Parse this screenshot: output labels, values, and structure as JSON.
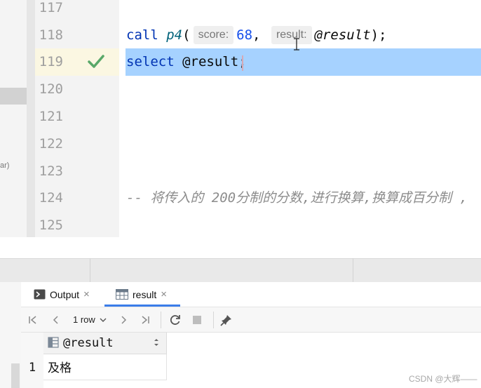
{
  "editor": {
    "line_numbers": [
      "117",
      "118",
      "119",
      "120",
      "121",
      "122",
      "123",
      "124",
      "125"
    ],
    "line118": {
      "kw_call": "call",
      "fn_name": "p4",
      "open_paren": "(",
      "hint_score": "score:",
      "arg_score": "68",
      "comma": ",",
      "hint_result": "result:",
      "arg_result": "@result",
      "close": ");"
    },
    "line119": {
      "kw_select": "select",
      "var": "@result",
      "semicolon": ";"
    },
    "line124_comment": "-- 将传入的 200分制的分数,进行换算,换算成百分制 ,",
    "line119_status": "check-icon",
    "left_panel_fragment": "ar)"
  },
  "tool_window": {
    "tabs": [
      {
        "label": "Output",
        "icon": "output-icon"
      },
      {
        "label": "result",
        "icon": "table-icon"
      }
    ],
    "close_glyph": "×",
    "toolbar": {
      "rows_selector": "1 row",
      "icons": [
        "first-page-icon",
        "prev-page-icon",
        "next-page-icon",
        "last-page-icon",
        "refresh-icon",
        "stop-icon",
        "pin-icon"
      ]
    },
    "grid": {
      "columns": [
        "@result"
      ],
      "rows": [
        {
          "num": "1",
          "values": [
            "及格"
          ]
        }
      ]
    }
  },
  "watermark": "CSDN @大辉——",
  "colors": {
    "selection": "#a6d2ff",
    "keyword": "#0033b3",
    "number": "#1750eb",
    "comment": "#8c8c8c",
    "check": "#59a869",
    "tab_underline": "#3b7de9"
  }
}
